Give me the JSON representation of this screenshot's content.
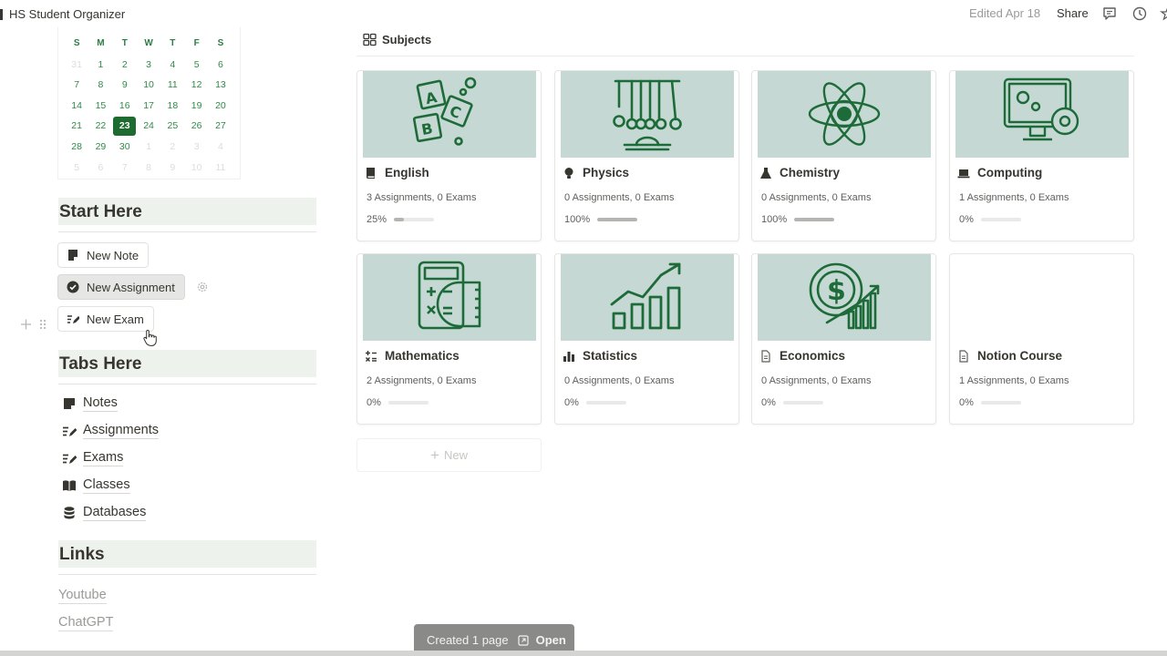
{
  "header": {
    "title": "HS Student Organizer",
    "edited": "Edited Apr 18",
    "share": "Share"
  },
  "calendar": {
    "weekdays": [
      "S",
      "M",
      "T",
      "W",
      "T",
      "F",
      "S"
    ],
    "weeks": [
      [
        "31",
        "1",
        "2",
        "3",
        "4",
        "5",
        "6"
      ],
      [
        "7",
        "8",
        "9",
        "10",
        "11",
        "12",
        "13"
      ],
      [
        "14",
        "15",
        "16",
        "17",
        "18",
        "19",
        "20"
      ],
      [
        "21",
        "22",
        "23",
        "24",
        "25",
        "26",
        "27"
      ],
      [
        "28",
        "29",
        "30",
        "1",
        "2",
        "3",
        "4"
      ],
      [
        "5",
        "6",
        "7",
        "8",
        "9",
        "10",
        "11"
      ]
    ],
    "today": "23"
  },
  "start_here": {
    "heading": "Start Here",
    "new_note": "New Note",
    "new_assignment": "New Assignment",
    "new_exam": "New Exam"
  },
  "tabs_here": {
    "heading": "Tabs Here",
    "items": [
      "Notes",
      "Assignments",
      "Exams",
      "Classes",
      "Databases"
    ]
  },
  "links": {
    "heading": "Links",
    "items": [
      "Youtube",
      "ChatGPT"
    ]
  },
  "subjects": {
    "heading": "Subjects",
    "cards": [
      {
        "name": "English",
        "meta": "3 Assignments, 0 Exams",
        "progress_label": "25%",
        "progress": 0.25,
        "icon": "book-icon",
        "cover": "abc-blocks"
      },
      {
        "name": "Physics",
        "meta": "0 Assignments, 0 Exams",
        "progress_label": "100%",
        "progress": 1.0,
        "icon": "lightbulb-icon",
        "cover": "newtons-cradle"
      },
      {
        "name": "Chemistry",
        "meta": "0 Assignments, 0 Exams",
        "progress_label": "100%",
        "progress": 1.0,
        "icon": "flask-icon",
        "cover": "atom"
      },
      {
        "name": "Computing",
        "meta": "1 Assignments, 0 Exams",
        "progress_label": "0%",
        "progress": 0,
        "icon": "laptop-icon",
        "cover": "computer-gears"
      },
      {
        "name": "Mathematics",
        "meta": "2 Assignments, 0 Exams",
        "progress_label": "0%",
        "progress": 0,
        "icon": "math-operators-icon",
        "cover": "calculator"
      },
      {
        "name": "Statistics",
        "meta": "0 Assignments, 0 Exams",
        "progress_label": "0%",
        "progress": 0,
        "icon": "bar-chart-icon",
        "cover": "growth-chart"
      },
      {
        "name": "Economics",
        "meta": "0 Assignments, 0 Exams",
        "progress_label": "0%",
        "progress": 0,
        "icon": "document-icon",
        "cover": "dollar-chart"
      },
      {
        "name": "Notion Course",
        "meta": "1 Assignments, 0 Exams",
        "progress_label": "0%",
        "progress": 0,
        "icon": "document-icon",
        "cover": "none"
      }
    ],
    "new_label": "New"
  },
  "toast": {
    "message": "Created 1 page",
    "open": "Open"
  },
  "colors": {
    "accent_green": "#1e6b2f",
    "calendar_text": "#2f8a4a",
    "section_bg": "#edf3ec",
    "cover_bg": "#c6d8d4",
    "icon_green": "#1d6b38"
  }
}
